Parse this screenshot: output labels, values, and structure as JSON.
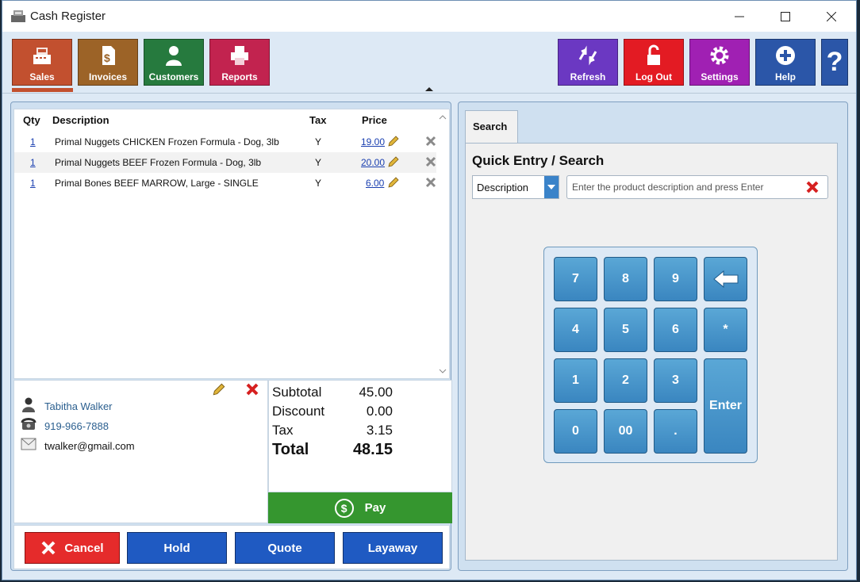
{
  "window": {
    "title": "Cash Register",
    "controls": {
      "minimize": "—",
      "maximize": "☐",
      "close": "✕"
    }
  },
  "toolbar": {
    "left": [
      {
        "label": "Sales",
        "icon": "register-icon",
        "color": "#c2502f"
      },
      {
        "label": "Invoices",
        "icon": "invoice-icon",
        "color": "#9c6327"
      },
      {
        "label": "Customers",
        "icon": "person-icon",
        "color": "#267a3e"
      },
      {
        "label": "Reports",
        "icon": "printer-icon",
        "color": "#c2234f"
      }
    ],
    "right": [
      {
        "label": "Refresh",
        "icon": "refresh-icon",
        "color": "#6b38c2"
      },
      {
        "label": "Log Out",
        "icon": "lock-icon",
        "color": "#e31b23"
      },
      {
        "label": "Settings",
        "icon": "gear-icon",
        "color": "#a020b3"
      },
      {
        "label": "Help",
        "icon": "plus-circle-icon",
        "color": "#2b56a8"
      }
    ],
    "help_question": "?"
  },
  "items": {
    "headers": {
      "qty": "Qty",
      "description": "Description",
      "tax": "Tax",
      "price": "Price"
    },
    "rows": [
      {
        "qty": "1",
        "description": "Primal Nuggets CHICKEN Frozen Formula - Dog, 3lb",
        "tax": "Y",
        "price": "19.00"
      },
      {
        "qty": "1",
        "description": "Primal Nuggets BEEF Frozen Formula - Dog, 3lb",
        "tax": "Y",
        "price": "20.00"
      },
      {
        "qty": "1",
        "description": "Primal Bones BEEF MARROW, Large - SINGLE",
        "tax": "Y",
        "price": "6.00"
      }
    ]
  },
  "customer": {
    "name": "Tabitha Walker",
    "phone": "919-966-7888",
    "email": "twalker@gmail.com"
  },
  "totals": {
    "subtotal_label": "Subtotal",
    "subtotal": "45.00",
    "discount_label": "Discount",
    "discount": "0.00",
    "tax_label": "Tax",
    "tax": "3.15",
    "total_label": "Total",
    "total": "48.15"
  },
  "pay": {
    "label": "Pay",
    "symbol": "$"
  },
  "actions": {
    "cancel": "Cancel",
    "hold": "Hold",
    "quote": "Quote",
    "layaway": "Layaway"
  },
  "search": {
    "tab": "Search",
    "title": "Quick Entry / Search",
    "mode": "Description",
    "placeholder": "Enter the product description and press Enter"
  },
  "keypad": {
    "keys": [
      "7",
      "8",
      "9",
      "4",
      "5",
      "6",
      "*",
      "1",
      "2",
      "3",
      "0",
      "00",
      "."
    ],
    "enter": "Enter"
  },
  "colors": {
    "action_blue": "#1f5ac2",
    "cancel_red": "#e52b2b",
    "pay_green": "#35962f"
  }
}
